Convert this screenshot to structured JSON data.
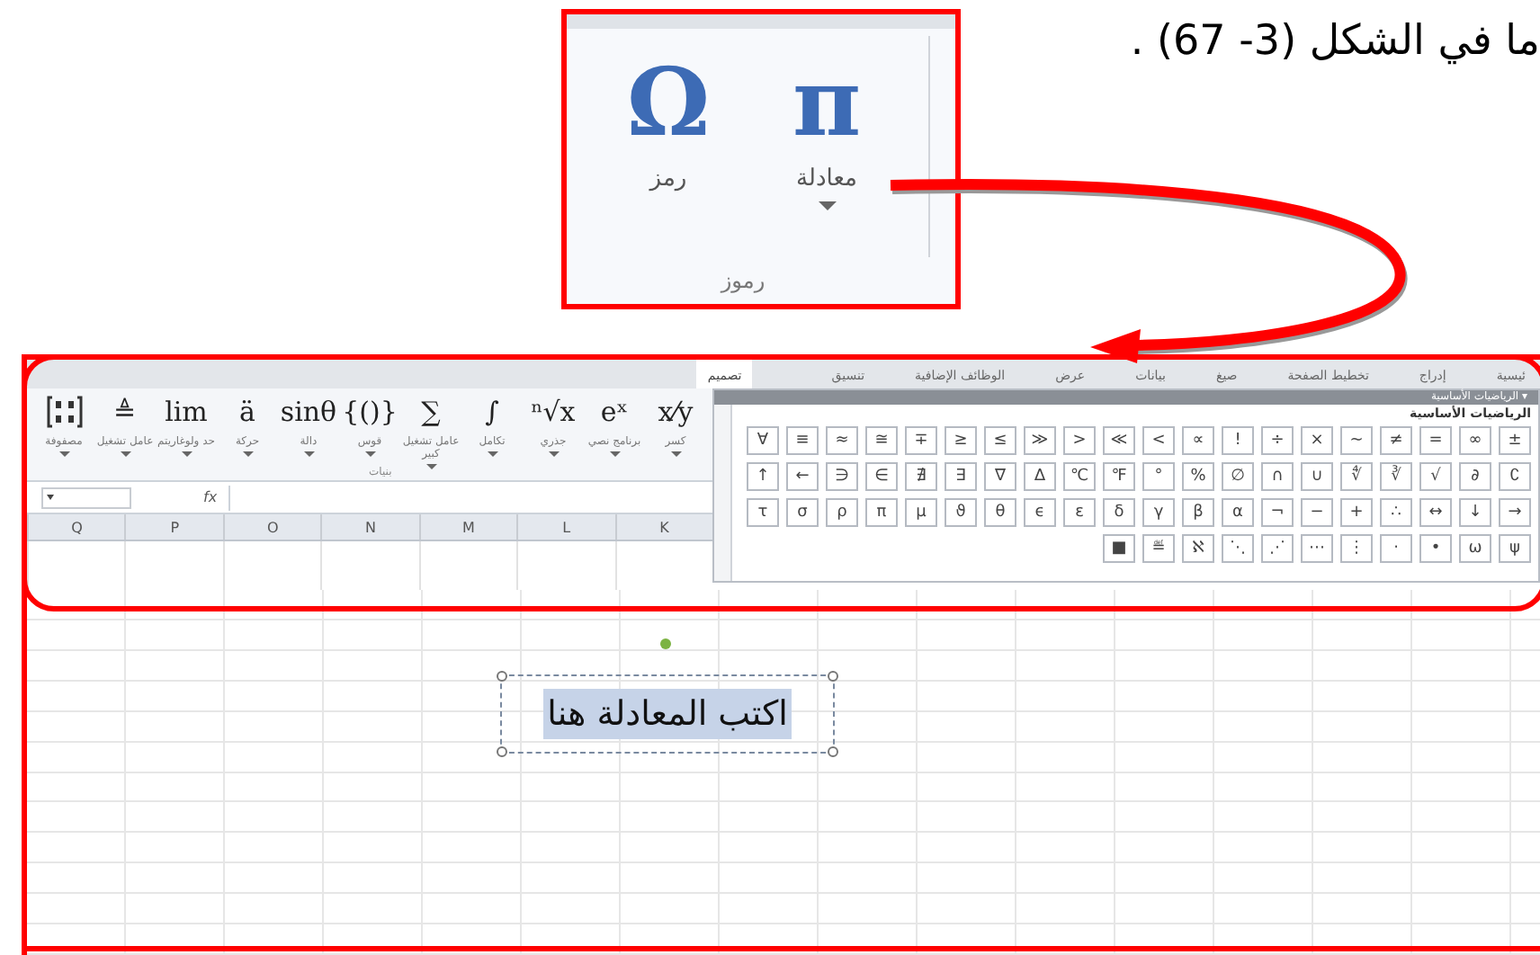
{
  "caption": "ما في الشكل (3- 67) .",
  "symbols_group": {
    "items": [
      {
        "glyph": "π",
        "label": "معادلة",
        "dropdown": true
      },
      {
        "glyph": "Ω",
        "label": "رمز",
        "dropdown": false
      }
    ],
    "group_label": "رموز"
  },
  "tabs": [
    {
      "label": "ئيسية",
      "selected": false
    },
    {
      "label": "إدراج",
      "selected": false
    },
    {
      "label": "تخطيط الصفحة",
      "selected": false
    },
    {
      "label": "صيغ",
      "selected": false
    },
    {
      "label": "بيانات",
      "selected": false
    },
    {
      "label": "عرض",
      "selected": false
    },
    {
      "label": "الوظائف الإضافية",
      "selected": false
    },
    {
      "label": "تنسيق",
      "selected": false
    },
    {
      "label": "تصميم",
      "selected": true
    }
  ],
  "ribbon": {
    "items": [
      {
        "kind": "text",
        "glyph": "x⁄y",
        "label": "كسر",
        "dropdown": true
      },
      {
        "kind": "text",
        "glyph": "eˣ",
        "label": "برنامج نصي",
        "dropdown": true
      },
      {
        "kind": "text",
        "glyph": "ⁿ√x",
        "label": "جذري",
        "dropdown": true
      },
      {
        "kind": "text",
        "glyph": "∫",
        "label": "تكامل",
        "dropdown": true
      },
      {
        "kind": "text",
        "glyph": "∑",
        "label": "عامل تشغيل كبير",
        "dropdown": true
      },
      {
        "kind": "text",
        "glyph": "{()}",
        "label": "قوس",
        "dropdown": true
      },
      {
        "kind": "text",
        "glyph": "sinθ",
        "label": "دالة",
        "dropdown": true
      },
      {
        "kind": "text",
        "glyph": "ä",
        "label": "حركة",
        "dropdown": true
      },
      {
        "kind": "text",
        "glyph": "lim",
        "label": "حد ولوغاريتم",
        "dropdown": true
      },
      {
        "kind": "text",
        "glyph": "≜",
        "label": "عامل تشغيل",
        "dropdown": true
      },
      {
        "kind": "matrix",
        "label": "مصفوفة",
        "dropdown": true
      }
    ],
    "group_label": "بنيات"
  },
  "formula_bar": {
    "fx": "fx"
  },
  "symbol_panel": {
    "title": "الرياضيات الأساسية",
    "title_caret": "▾",
    "heading": "الرياضيات الأساسية",
    "rows": [
      [
        "±",
        "∞",
        "=",
        "≠",
        "~",
        "×",
        "÷",
        "!",
        "∝",
        "<",
        "≪",
        ">",
        "≫",
        "≤",
        "≥",
        "∓",
        "≅",
        "≈",
        "≡",
        "∀"
      ],
      [
        "∁",
        "∂",
        "√",
        "∛",
        "∜",
        "∪",
        "∩",
        "∅",
        "%",
        "°",
        "℉",
        "℃",
        "∆",
        "∇",
        "∃",
        "∄",
        "∈",
        "∋",
        "←",
        "↑"
      ],
      [
        "→",
        "↓",
        "↔",
        "∴",
        "+",
        "−",
        "¬",
        "α",
        "β",
        "γ",
        "δ",
        "ε",
        "ϵ",
        "θ",
        "ϑ",
        "μ",
        "π",
        "ρ",
        "σ",
        "τ"
      ],
      [
        "ψ",
        "ω",
        "•",
        "·",
        "⋮",
        "⋯",
        "⋰",
        "⋱",
        "ℵ",
        "≝",
        "■"
      ]
    ]
  },
  "columns": [
    "K",
    "L",
    "M",
    "N",
    "O",
    "P",
    "Q"
  ],
  "equation": {
    "text": "اكتب المعادلة هنا",
    "selected": true
  }
}
